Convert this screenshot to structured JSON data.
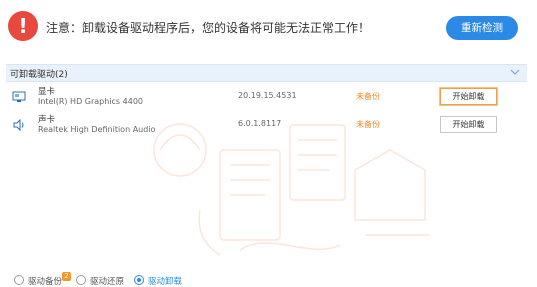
{
  "warning": {
    "icon": "exclamation-icon",
    "text": "注意：卸载设备驱动程序后，您的设备将可能无法正常工作！",
    "recheck_label": "重新检测"
  },
  "section": {
    "title": "可卸载驱动(2)",
    "toggle_icon": "chevron-down-icon"
  },
  "drivers": [
    {
      "icon": "monitor-icon",
      "name": "显卡",
      "model": "Intel(R) HD Graphics 4400",
      "version": "20.19.15.4531",
      "status": "未备份",
      "action": "开始卸载"
    },
    {
      "icon": "speaker-icon",
      "name": "声卡",
      "model": "Realtek High Definition Audio",
      "version": "6.0.1.8117",
      "status": "未备份",
      "action": "开始卸载"
    }
  ],
  "footer": {
    "options": [
      "驱动备份",
      "驱动还原",
      "驱动卸载"
    ],
    "selected": "驱动卸载",
    "badge": "2"
  },
  "colors": {
    "accent": "#2b8ae6",
    "warning": "#e8483d",
    "status": "#f08a24"
  }
}
